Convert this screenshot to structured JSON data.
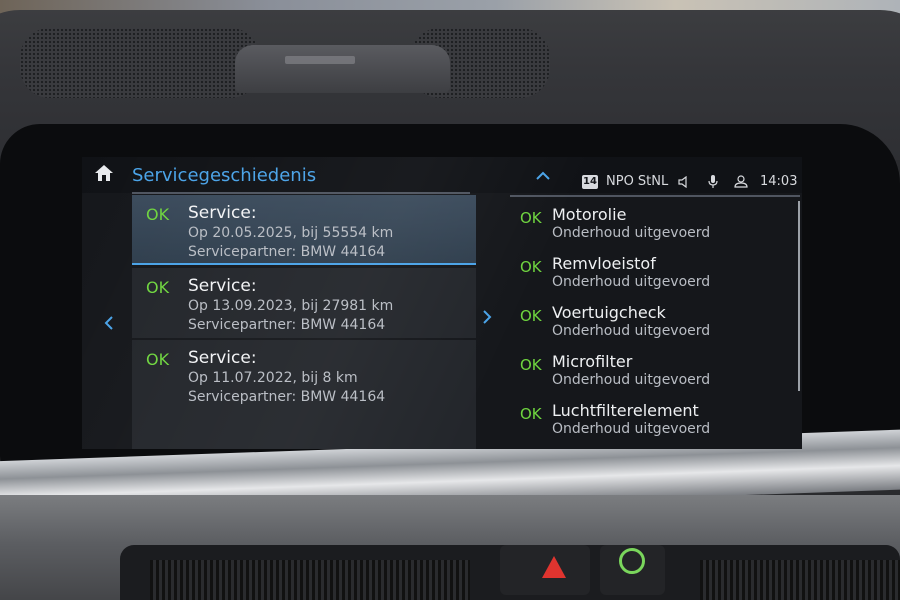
{
  "header": {
    "title": "Servicegeschiedenis",
    "channel_number": "14",
    "station": "NPO StNL",
    "time": "14:03"
  },
  "history": [
    {
      "status": "OK",
      "title": "Service:",
      "date_line": "Op 20.05.2025, bij 55554 km",
      "partner_line": "Servicepartner: BMW 44164"
    },
    {
      "status": "OK",
      "title": "Service:",
      "date_line": "Op 13.09.2023, bij 27981 km",
      "partner_line": "Servicepartner: BMW 44164"
    },
    {
      "status": "OK",
      "title": "Service:",
      "date_line": "Op 11.07.2022, bij 8 km",
      "partner_line": "Servicepartner: BMW 44164"
    }
  ],
  "checks": [
    {
      "status": "OK",
      "name": "Motorolie",
      "detail": "Onderhoud uitgevoerd"
    },
    {
      "status": "OK",
      "name": "Remvloeistof",
      "detail": "Onderhoud uitgevoerd"
    },
    {
      "status": "OK",
      "name": "Voertuigcheck",
      "detail": "Onderhoud uitgevoerd"
    },
    {
      "status": "OK",
      "name": "Microfilter",
      "detail": "Onderhoud uitgevoerd"
    },
    {
      "status": "OK",
      "name": "Luchtfilterelement",
      "detail": "Onderhoud uitgevoerd"
    }
  ],
  "icons": {
    "home": "home-icon",
    "collapse": "chevron-up-icon",
    "volume": "speaker-icon",
    "mic": "microphone-icon",
    "user": "user-icon",
    "prev": "chevron-left-icon",
    "next": "chevron-right-icon"
  },
  "colors": {
    "accent": "#4aa3e8",
    "ok_green": "#6fd53f",
    "hazard_red": "#e0342f"
  }
}
